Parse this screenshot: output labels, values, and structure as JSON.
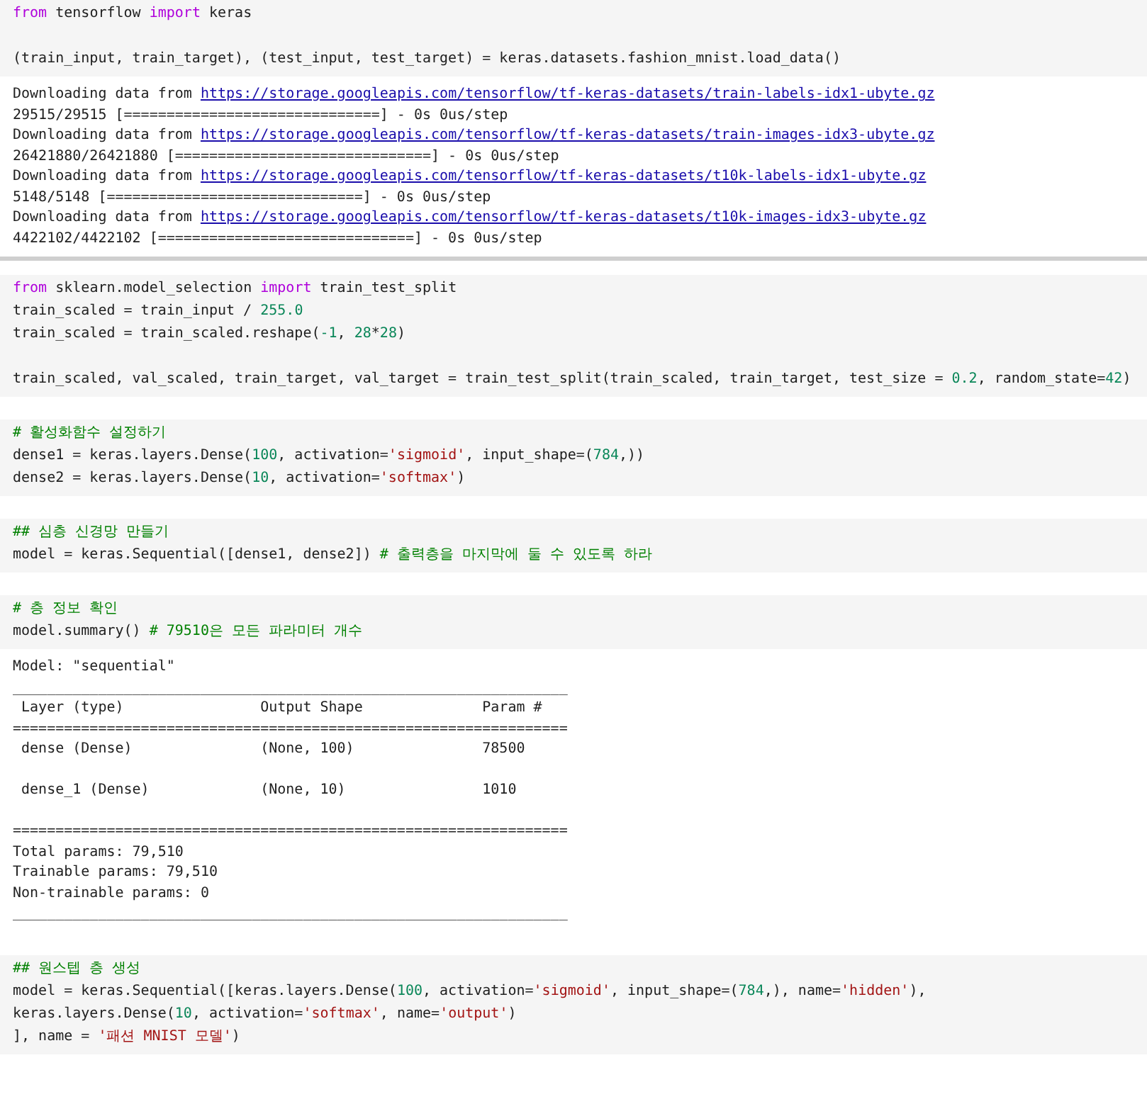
{
  "cells": [
    {
      "code": [
        {
          "kind": "code",
          "tokens": [
            {
              "text": "from",
              "kind": "keyword"
            },
            {
              "text": " tensorflow ",
              "kind": "plain"
            },
            {
              "text": "import",
              "kind": "keyword"
            },
            {
              "text": " keras",
              "kind": "plain"
            }
          ]
        },
        {
          "kind": "blank"
        },
        {
          "kind": "code",
          "tokens": [
            {
              "text": "(train_input, train_target), (test_input, test_target) = keras.datasets.fashion_mnist.load_data()",
              "kind": "plain"
            }
          ]
        }
      ],
      "output": [
        {
          "kind": "download",
          "lead": "Downloading data from",
          "url": "https://storage.googleapis.com/tensorflow/tf-keras-datasets/train-labels-idx1-ubyte.gz"
        },
        {
          "kind": "text",
          "text": "29515/29515 [==============================] - 0s 0us/step"
        },
        {
          "kind": "download",
          "lead": "Downloading data from",
          "url": "https://storage.googleapis.com/tensorflow/tf-keras-datasets/train-images-idx3-ubyte.gz"
        },
        {
          "kind": "text",
          "text": "26421880/26421880 [==============================] - 0s 0us/step"
        },
        {
          "kind": "download",
          "lead": "Downloading data from",
          "url": "https://storage.googleapis.com/tensorflow/tf-keras-datasets/t10k-labels-idx1-ubyte.gz"
        },
        {
          "kind": "text",
          "text": "5148/5148 [==============================] - 0s 0us/step"
        },
        {
          "kind": "download",
          "lead": "Downloading data from",
          "url": "https://storage.googleapis.com/tensorflow/tf-keras-datasets/t10k-images-idx3-ubyte.gz"
        },
        {
          "kind": "text",
          "text": "4422102/4422102 [==============================] - 0s 0us/step"
        }
      ]
    },
    {
      "code": [
        {
          "kind": "code",
          "tokens": [
            {
              "text": "from",
              "kind": "keyword"
            },
            {
              "text": " sklearn.model_selection ",
              "kind": "plain"
            },
            {
              "text": "import",
              "kind": "keyword"
            },
            {
              "text": " train_test_split",
              "kind": "plain"
            }
          ]
        },
        {
          "kind": "code",
          "tokens": [
            {
              "text": "train_scaled = train_input / ",
              "kind": "plain"
            },
            {
              "text": "255.0",
              "kind": "number"
            }
          ]
        },
        {
          "kind": "code",
          "tokens": [
            {
              "text": "train_scaled = train_scaled.reshape(",
              "kind": "plain"
            },
            {
              "text": "-1",
              "kind": "number"
            },
            {
              "text": ", ",
              "kind": "plain"
            },
            {
              "text": "28",
              "kind": "number"
            },
            {
              "text": "*",
              "kind": "plain"
            },
            {
              "text": "28",
              "kind": "number"
            },
            {
              "text": ")",
              "kind": "plain"
            }
          ]
        },
        {
          "kind": "blank"
        },
        {
          "kind": "code",
          "tokens": [
            {
              "text": "train_scaled, val_scaled, train_target, val_target = train_test_split(train_scaled, train_target, test_size = ",
              "kind": "plain"
            },
            {
              "text": "0.2",
              "kind": "number"
            },
            {
              "text": ", random_state=",
              "kind": "plain"
            },
            {
              "text": "42",
              "kind": "number"
            },
            {
              "text": ")",
              "kind": "plain"
            }
          ]
        }
      ]
    },
    {
      "code": [
        {
          "kind": "code",
          "tokens": [
            {
              "text": "# 활성화함수 설정하기",
              "kind": "comment"
            }
          ]
        },
        {
          "kind": "code",
          "tokens": [
            {
              "text": "dense1 = keras.layers.Dense(",
              "kind": "plain"
            },
            {
              "text": "100",
              "kind": "number"
            },
            {
              "text": ", activation=",
              "kind": "plain"
            },
            {
              "text": "'sigmoid'",
              "kind": "string"
            },
            {
              "text": ", input_shape=(",
              "kind": "plain"
            },
            {
              "text": "784",
              "kind": "number"
            },
            {
              "text": ",))",
              "kind": "plain"
            }
          ]
        },
        {
          "kind": "code",
          "tokens": [
            {
              "text": "dense2 = keras.layers.Dense(",
              "kind": "plain"
            },
            {
              "text": "10",
              "kind": "number"
            },
            {
              "text": ", activation=",
              "kind": "plain"
            },
            {
              "text": "'softmax'",
              "kind": "string"
            },
            {
              "text": ")",
              "kind": "plain"
            }
          ]
        }
      ]
    },
    {
      "code": [
        {
          "kind": "code",
          "tokens": [
            {
              "text": "## 심층 신경망 만들기",
              "kind": "comment"
            }
          ]
        },
        {
          "kind": "code",
          "tokens": [
            {
              "text": "model = keras.Sequential([dense1, dense2]) ",
              "kind": "plain"
            },
            {
              "text": "# 출력층을 마지막에 둘 수 있도록 하라",
              "kind": "comment"
            }
          ]
        }
      ]
    },
    {
      "code": [
        {
          "kind": "code",
          "tokens": [
            {
              "text": "# 층 정보 확인",
              "kind": "comment"
            }
          ]
        },
        {
          "kind": "code",
          "tokens": [
            {
              "text": "model.summary() ",
              "kind": "plain"
            },
            {
              "text": "# 79510은 모든 파라미터 개수",
              "kind": "comment"
            }
          ]
        }
      ],
      "output": [
        {
          "kind": "text",
          "text": "Model: \"sequential\""
        },
        {
          "kind": "text",
          "text": "_________________________________________________________________"
        },
        {
          "kind": "text",
          "text": " Layer (type)                Output Shape              Param #"
        },
        {
          "kind": "text",
          "text": "================================================================="
        },
        {
          "kind": "text",
          "text": " dense (Dense)               (None, 100)               78500"
        },
        {
          "kind": "blank"
        },
        {
          "kind": "text",
          "text": " dense_1 (Dense)             (None, 10)                1010"
        },
        {
          "kind": "blank"
        },
        {
          "kind": "text",
          "text": "================================================================="
        },
        {
          "kind": "text",
          "text": "Total params: 79,510"
        },
        {
          "kind": "text",
          "text": "Trainable params: 79,510"
        },
        {
          "kind": "text",
          "text": "Non-trainable params: 0"
        },
        {
          "kind": "text",
          "text": "_________________________________________________________________"
        }
      ]
    },
    {
      "code": [
        {
          "kind": "code",
          "tokens": [
            {
              "text": "## 원스텝 층 생성",
              "kind": "comment"
            }
          ]
        },
        {
          "kind": "code",
          "tokens": [
            {
              "text": "model = keras.Sequential([keras.layers.Dense(",
              "kind": "plain"
            },
            {
              "text": "100",
              "kind": "number"
            },
            {
              "text": ", activation=",
              "kind": "plain"
            },
            {
              "text": "'sigmoid'",
              "kind": "string"
            },
            {
              "text": ", input_shape=(",
              "kind": "plain"
            },
            {
              "text": "784",
              "kind": "number"
            },
            {
              "text": ",), name=",
              "kind": "plain"
            },
            {
              "text": "'hidden'",
              "kind": "string"
            },
            {
              "text": "),",
              "kind": "plain"
            }
          ]
        },
        {
          "kind": "code",
          "tokens": [
            {
              "text": "keras.layers.Dense(",
              "kind": "plain"
            },
            {
              "text": "10",
              "kind": "number"
            },
            {
              "text": ", activation=",
              "kind": "plain"
            },
            {
              "text": "'softmax'",
              "kind": "string"
            },
            {
              "text": ", name=",
              "kind": "plain"
            },
            {
              "text": "'output'",
              "kind": "string"
            },
            {
              "text": ")",
              "kind": "plain"
            }
          ]
        },
        {
          "kind": "code",
          "tokens": [
            {
              "text": "], name = ",
              "kind": "plain"
            },
            {
              "text": "'패션 MNIST 모델'",
              "kind": "string"
            },
            {
              "text": ")",
              "kind": "plain"
            }
          ]
        }
      ]
    }
  ]
}
